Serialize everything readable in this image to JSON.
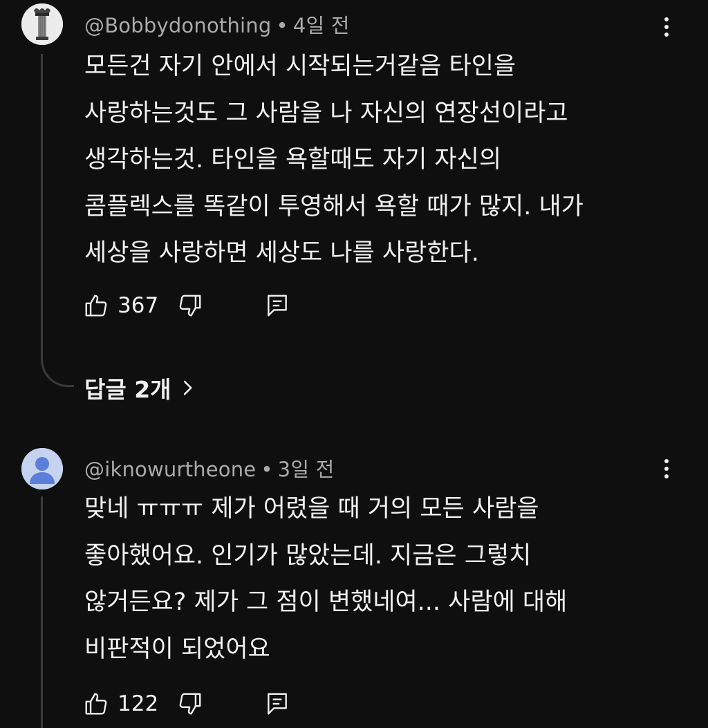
{
  "comments": [
    {
      "username": "@Bobbydonothing",
      "separator": "•",
      "time": "4일 전",
      "lines": [
        "모든건 자기 안에서 시작되는거같음 타인을",
        "사랑하는것도 그 사람을 나 자신의 연장선이라고",
        "생각하는것. 타인을 욕할때도 자기 자신의",
        "콤플렉스를 똑같이 투영해서 욕할 때가 많지. 내가",
        "세상을 사랑하면 세상도 나를 사랑한다."
      ],
      "likes": "367",
      "replies_label": "답글 2개"
    },
    {
      "username": "@iknowurtheone",
      "separator": "•",
      "time": "3일 전",
      "lines": [
        "맞네 ㅠㅠㅠ 제가 어렸을 때 거의 모든 사람을",
        "좋아했어요. 인기가 많았는데. 지금은 그렇치",
        "않거든요? 제가 그 점이 변했네여... 사람에 대해",
        "비판적이 되었어요"
      ],
      "likes": "122"
    }
  ],
  "icons": {
    "like": "thumbs-up-icon",
    "dislike": "thumbs-down-icon",
    "reply": "comment-reply-icon",
    "more": "more-vertical-icon",
    "chevron": "chevron-right-icon"
  },
  "colors": {
    "background": "#0f0f0f",
    "text": "#f1f1f1",
    "meta_text": "#aaaaaa",
    "thread_line": "#3a3a3a",
    "avatar_default": "#c5d3f0",
    "avatar_default_fg": "#5b7ed8"
  }
}
